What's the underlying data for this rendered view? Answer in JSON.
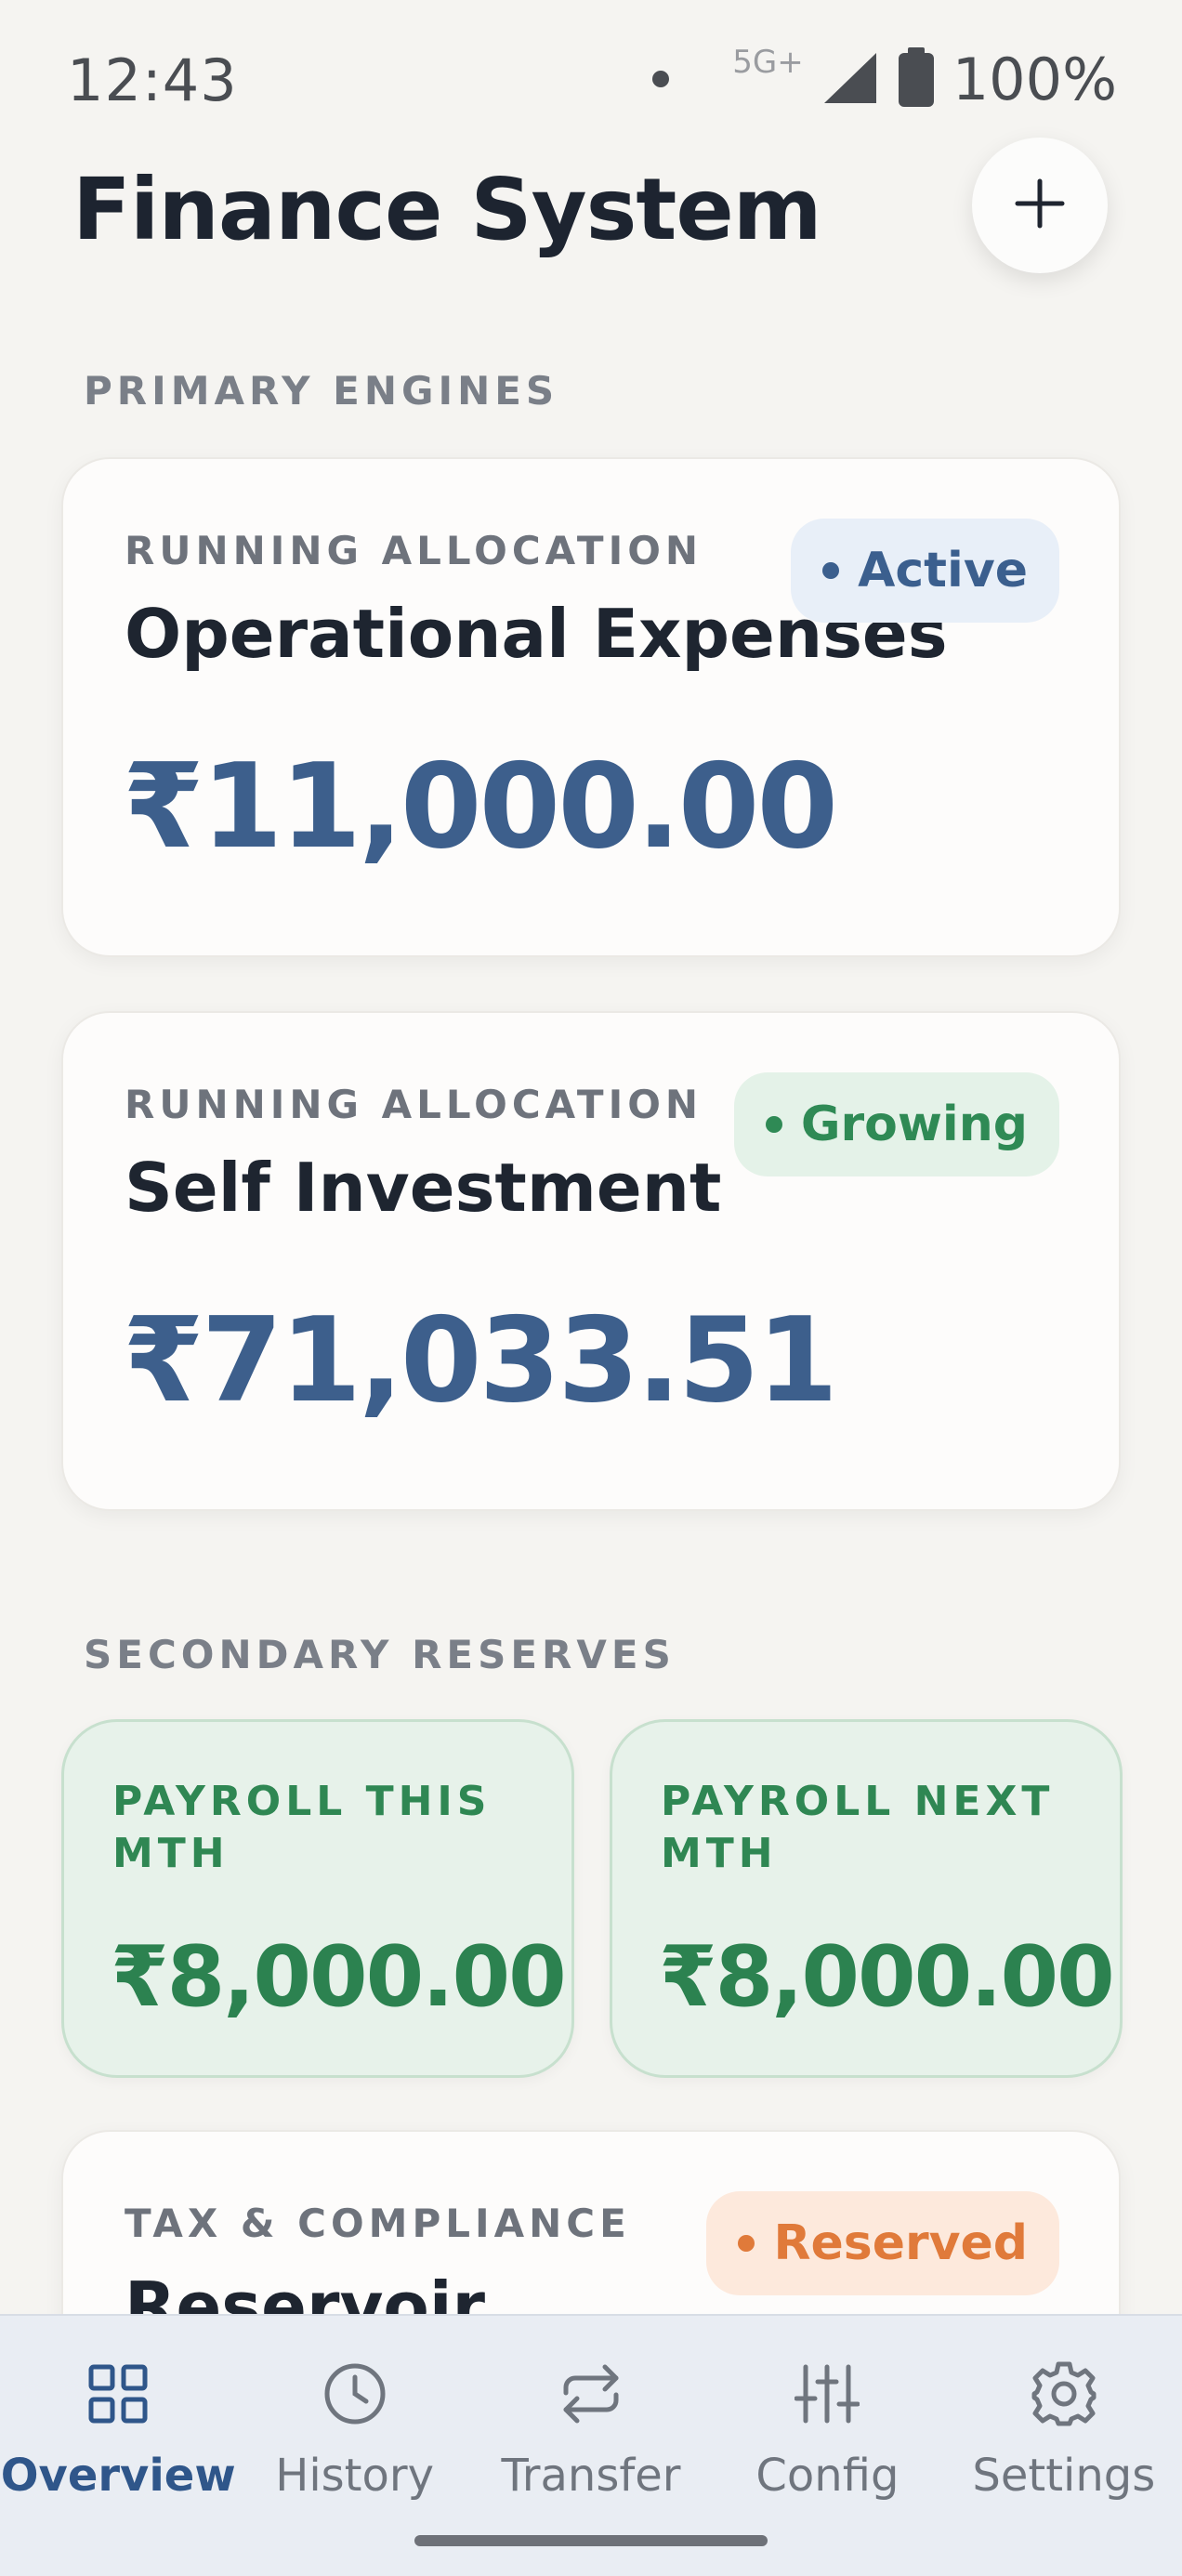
{
  "status_bar": {
    "time": "12:43",
    "network": "5G+",
    "battery": "100%"
  },
  "header": {
    "title": "Finance System",
    "add_icon": "plus-icon"
  },
  "sections": {
    "primary": "PRIMARY ENGINES",
    "secondary": "SECONDARY RESERVES"
  },
  "primary_cards": [
    {
      "eyebrow": "RUNNING ALLOCATION",
      "title": "Operational Expenses",
      "amount": "₹11,000.00",
      "badge": "Active",
      "badge_color": "#3b5f8e",
      "badge_bg": "#e8eff8"
    },
    {
      "eyebrow": "RUNNING ALLOCATION",
      "title": "Self Investment",
      "amount": "₹71,033.51",
      "badge": "Growing",
      "badge_color": "#2f8a55",
      "badge_bg": "#e4f2e8"
    }
  ],
  "reserves": [
    {
      "label": "PAYROLL THIS MTH",
      "amount": "₹8,000.00"
    },
    {
      "label": "PAYROLL NEXT MTH",
      "amount": "₹8,000.00"
    }
  ],
  "tax_card": {
    "eyebrow": "TAX & COMPLIANCE",
    "title": "Reservoir",
    "badge": "Reserved",
    "badge_color": "#e07a3a",
    "badge_bg": "#fde9dc"
  },
  "nav": {
    "items": [
      {
        "label": "Overview",
        "icon": "grid-icon",
        "active": true
      },
      {
        "label": "History",
        "icon": "clock-icon",
        "active": false
      },
      {
        "label": "Transfer",
        "icon": "transfer-icon",
        "active": false
      },
      {
        "label": "Config",
        "icon": "sliders-icon",
        "active": false
      },
      {
        "label": "Settings",
        "icon": "gear-icon",
        "active": false
      }
    ]
  },
  "colors": {
    "accent": "#2f568a",
    "reserve_green": "#2c8250"
  }
}
